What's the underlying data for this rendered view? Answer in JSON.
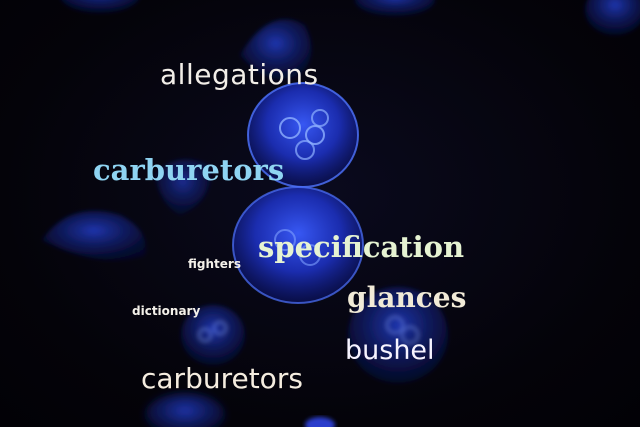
{
  "words": [
    {
      "id": "allegations",
      "text": "allegations"
    },
    {
      "id": "carburetors_1",
      "text": "carburetors"
    },
    {
      "id": "fighters",
      "text": "fighters"
    },
    {
      "id": "specification",
      "text": "specification"
    },
    {
      "id": "glances",
      "text": "glances"
    },
    {
      "id": "dictionary",
      "text": "dictionary"
    },
    {
      "id": "bushel",
      "text": "bushel"
    },
    {
      "id": "carburetors_2",
      "text": "carburetors"
    }
  ],
  "colors": {
    "background": "#050308",
    "jellyfish_glow": "#2a4cff",
    "jellyfish_body": "#1a2bb8"
  }
}
